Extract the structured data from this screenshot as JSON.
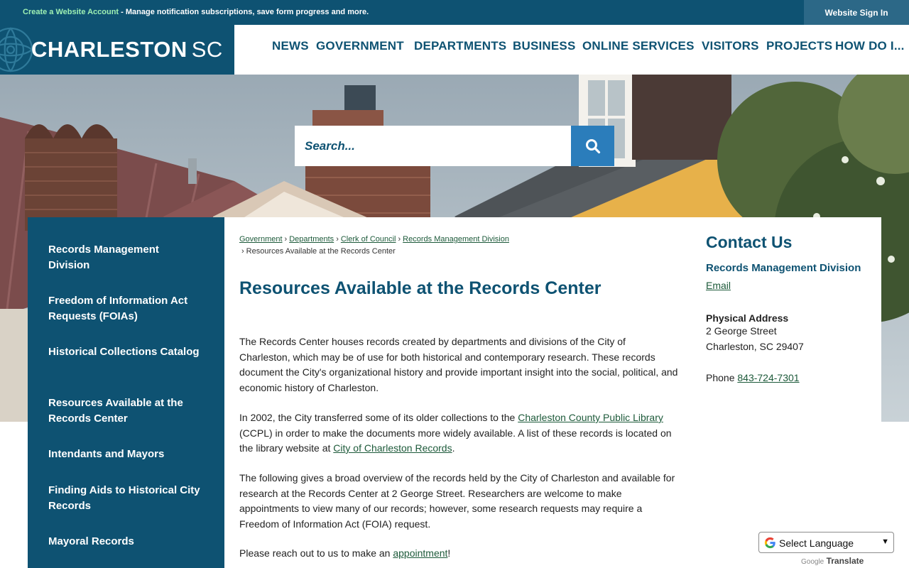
{
  "topbar": {
    "create_account_link": "Create a Website Account",
    "create_account_desc": " - Manage notification subscriptions, save form progress and more.",
    "sign_in_button": "Website Sign In"
  },
  "header": {
    "logo_main": "CHARLESTON",
    "logo_sc": "SC",
    "nav": [
      "NEWS",
      "GOVERNMENT",
      "DEPARTMENTS",
      "BUSINESS",
      "ONLINE SERVICES",
      "VISITORS",
      "PROJECTS",
      "HOW DO I..."
    ]
  },
  "search": {
    "placeholder": "Search...",
    "button_icon": "search-icon"
  },
  "sidebar": {
    "items": [
      "Records Management Division",
      "Freedom of Information Act Requests (FOIAs)",
      "Historical Collections Catalog",
      "Resources Available at the Records Center",
      "Intendants and Mayors",
      "Finding Aids to Historical City Records",
      "Mayoral Records"
    ]
  },
  "breadcrumb": {
    "links": [
      "Government",
      "Departments",
      "Clerk of Council",
      "Records Management Division"
    ],
    "separator": "›",
    "current": "Resources Available at the Records Center"
  },
  "page": {
    "title": "Resources Available at the Records Center",
    "p1": "The Records Center houses  records created by departments and divisions of the City of Charleston, which may be of use for both historical and contemporary research. These records document the City's organizational history and provide important insight into the social, political, and economic history of Charleston.",
    "p2_a": "In 2002, the City transferred some of its older collections to the ",
    "p2_link1": "Charleston County Public Library",
    "p2_b": " (CCPL) in order to make the documents more widely available. A list of these records is located on the library website at ",
    "p2_link2": "City of Charleston Records",
    "p2_c": ".",
    "p3": "The following gives a broad overview of the records held by the City of Charleston and available for research at the Records Center at 2 George Street. Researchers are welcome to make appointments to view many of our records; however, some research requests may require a Freedom of Information Act (FOIA) request.",
    "p4_a": "Please reach out to us to make an ",
    "p4_link": "appointment",
    "p4_b": "!"
  },
  "contact": {
    "heading": "Contact Us",
    "division": "Records Management Division",
    "email_link": "Email",
    "address_label": "Physical Address",
    "address_line1": "2 George Street",
    "address_line2": "Charleston, SC 29407",
    "phone_label": "Phone ",
    "phone_number": "843-724-7301"
  },
  "translate": {
    "select_label": "Select Language",
    "powered_google": "Google",
    "powered_translate": "Translate"
  },
  "colors": {
    "brand_navy": "#0e5272",
    "accent_blue": "#2b7dbb",
    "link_green": "#1d5a3a",
    "topbar_link": "#9ef0b3"
  }
}
